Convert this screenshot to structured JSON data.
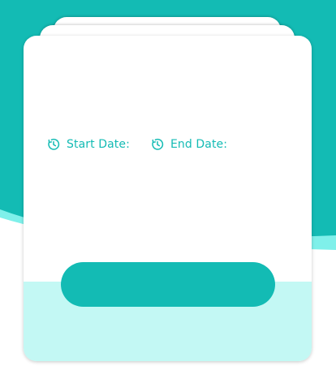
{
  "colors": {
    "primary": "#13bbb4",
    "accent_light": "#7ff0ea",
    "card_footer": "#c3f8f4",
    "card": "#ffffff"
  },
  "dates": {
    "start": {
      "label": "Start Date:",
      "icon": "clock-icon"
    },
    "end": {
      "label": "End Date:",
      "icon": "clock-icon"
    }
  },
  "action_button": {
    "label": ""
  }
}
